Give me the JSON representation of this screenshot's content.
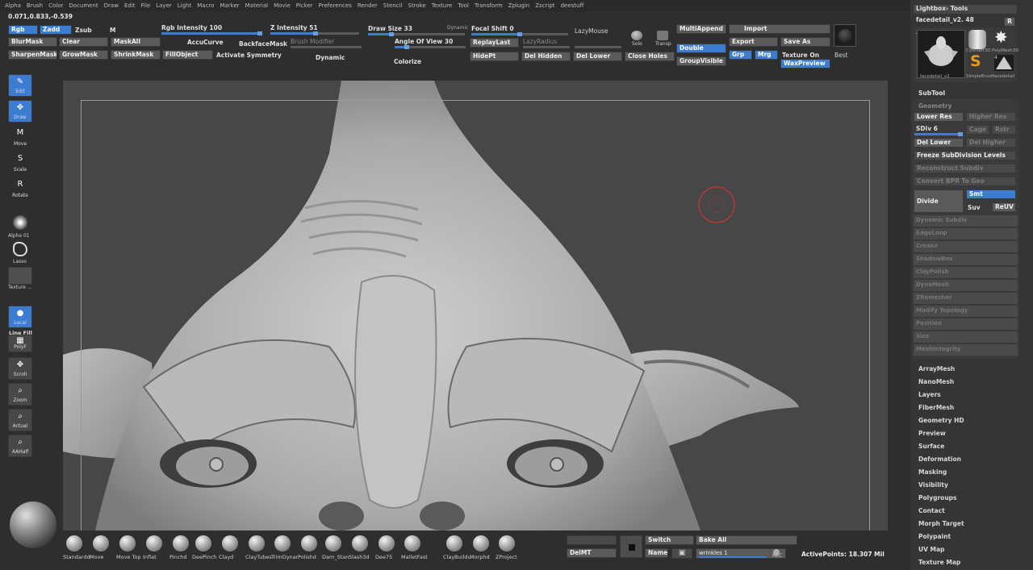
{
  "menu": [
    "Alpha",
    "Brush",
    "Color",
    "Document",
    "Draw",
    "Edit",
    "File",
    "Layer",
    "Light",
    "Macro",
    "Marker",
    "Material",
    "Movie",
    "Picker",
    "Preferences",
    "Render",
    "Stencil",
    "Stroke",
    "Texture",
    "Tool",
    "Transform",
    "Zplugin",
    "Zscript",
    "deestuff"
  ],
  "coords": "0.071,0.833,-0.539",
  "top": {
    "rgb": "Rgb",
    "zadd": "Zadd",
    "zsub": "Zsub",
    "m": "M",
    "rgb_intensity": "Rgb Intensity 100",
    "z_intensity": "Z Intensity 51",
    "blurmask": "BlurMask",
    "clear": "Clear",
    "maskall": "MaskAll",
    "accucurve": "AccuCurve",
    "backfacemask": "BackfaceMask",
    "brush_modifier": "Brush Modifier",
    "sharpenmask": "SharpenMask",
    "growmask": "GrowMask",
    "shrinkmask": "ShrinkMask",
    "fillobject": "FillObject",
    "activate_symmetry": "Activate Symmetry",
    "dynamic": "Dynamic",
    "draw_size": "Draw Size 33",
    "dynamic_small": "Dynamic",
    "angle_of_view": "Angle Of View 30",
    "colorize": "Colorize",
    "focal_shift": "Focal Shift 0",
    "replaylast": "ReplayLast",
    "lazyradius": "LazyRadius",
    "lazymouse": "LazyMouse",
    "hidept": "HidePt",
    "del_hidden": "Del Hidden",
    "del_lower": "Del Lower",
    "close_holes": "Close Holes",
    "solo": "Solo",
    "transp": "Transp",
    "multiappend": "MultiAppend",
    "import": "Import",
    "double": "Double",
    "export": "Export",
    "save_as": "Save As",
    "groupvisible": "GroupVisible",
    "grp": "Grp",
    "mrg": "Mrg",
    "texture_on": "Texture On",
    "waxpreview": "WaxPreview",
    "best": "Best"
  },
  "left": {
    "edit": "Edit",
    "draw": "Draw",
    "move": "Move",
    "scale": "Scale",
    "rotate": "Rotate",
    "alpha": "Alpha 01",
    "lasso": "Lasso",
    "texture": "Texture ...",
    "local": "Local",
    "line_fill": "Line Fill",
    "polyf": "PolyF",
    "scroll": "Scroll",
    "zoom": "Zoom",
    "actual": "Actual",
    "aahalf": "AAHalf"
  },
  "right": {
    "lightbox_tools": "Lightbox› Tools",
    "tool_name": "facedetail_v2. 48",
    "r_btn": "R",
    "count": "4",
    "thumbs": [
      "facedetail_v2",
      "Cylinder3D",
      "PolyMesh3D",
      "SimpleBrush",
      "facedetail"
    ],
    "subtool": "SubTool",
    "geometry": "Geometry",
    "lower_res": "Lower Res",
    "higher_res": "Higher Res",
    "sdiv": "SDiv 6",
    "cage": "Cage",
    "rstr": "Rstr",
    "del_lower": "Del Lower",
    "del_higher": "Del Higher",
    "freeze": "Freeze SubDivision Levels",
    "reconstruct": "Reconstruct Subdiv",
    "convert": "Convert BPR To Geo",
    "divide": "Divide",
    "smt": "Smt",
    "suv": "Suv",
    "reuv": "ReUV",
    "geo_items": [
      "Dynamic Subdiv",
      "EdgeLoop",
      "Crease",
      "ShadowBox",
      "ClayPolish",
      "DynaMesh",
      "ZRemesher",
      "Modify Topology",
      "Position",
      "Size",
      "MeshIntegrity"
    ],
    "menus": [
      "ArrayMesh",
      "NanoMesh",
      "Layers",
      "FiberMesh",
      "Geometry HD",
      "Preview",
      "Surface",
      "Deformation",
      "Masking",
      "Visibility",
      "Polygroups",
      "Contact",
      "Morph Target",
      "Polypaint",
      "UV Map",
      "Texture Map"
    ]
  },
  "brushes": [
    "Standardd",
    "Move",
    "Move Top",
    "Inflat",
    "Pinchd",
    "DeePinch",
    "Clayd",
    "ClayTubes",
    "TrimDynar",
    "Polishd",
    "Dam_Stan",
    "Slash3d",
    "Dee75",
    "MalletFast",
    "ClayBuildu",
    "Morphd",
    "ZProject"
  ],
  "bottom": {
    "delmt": "DelMT",
    "switch": "Switch",
    "name": "Name",
    "bake_all": "Bake All",
    "layer_name": "wrinkles 1",
    "rec": "REC",
    "active_points": "ActivePoints: 18.307 Mil"
  },
  "colors": {
    "accent": "#3d7dd1",
    "clay": "#b8b8b8",
    "background": "#474747"
  }
}
